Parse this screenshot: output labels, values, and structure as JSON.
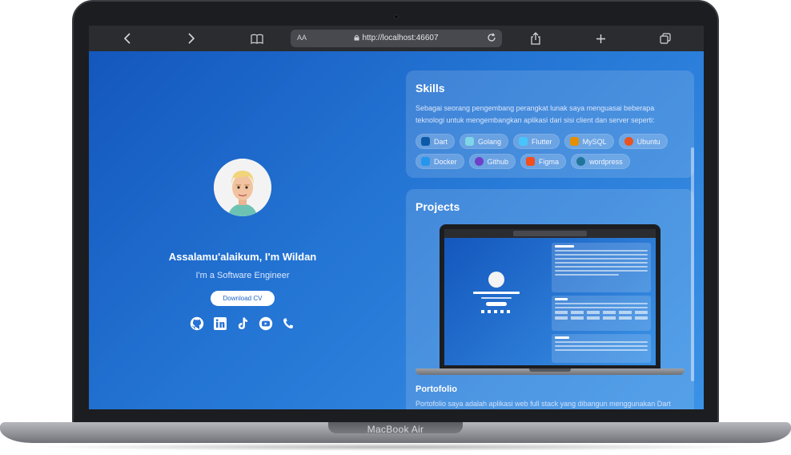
{
  "device": {
    "label": "MacBook Air"
  },
  "browser": {
    "back_icon": "chevron-left-icon",
    "forward_icon": "chevron-right-icon",
    "reader_icon": "book-icon",
    "text_size_label": "AA",
    "url": "http://localhost:46607",
    "reload_icon": "reload-icon",
    "share_icon": "share-icon",
    "new_tab_icon": "plus-icon",
    "tabs_icon": "tabs-icon"
  },
  "profile": {
    "greeting": "Assalamu'alaikum, I'm Wildan",
    "role": "I'm a Software Engineer",
    "cv_button": "Download CV",
    "socials": [
      "github-icon",
      "linkedin-icon",
      "tiktok-icon",
      "youtube-icon",
      "phone-icon"
    ]
  },
  "skills": {
    "title": "Skills",
    "description": "Sebagai seorang pengembang perangkat lunak saya menguasai beberapa teknologi untuk mengembangkan aplikasi dari sisi client dan server seperti:",
    "items": [
      {
        "label": "Dart",
        "color": "#0d5aa8"
      },
      {
        "label": "Golang",
        "color": "#7fd6e8"
      },
      {
        "label": "Flutter",
        "color": "#47c5fb"
      },
      {
        "label": "MySQL",
        "color": "#e48e00"
      },
      {
        "label": "Ubuntu",
        "color": "#e95420"
      },
      {
        "label": "Docker",
        "color": "#2496ed"
      },
      {
        "label": "Github",
        "color": "#6e40c9"
      },
      {
        "label": "Figma",
        "color": "#f24e1e"
      },
      {
        "label": "wordpress",
        "color": "#21759b"
      }
    ]
  },
  "projects": {
    "title": "Projects",
    "portfolio_title": "Portofolio",
    "portfolio_desc": "Portofolio saya adalah aplikasi web full stack yang dibangun menggunakan Dart"
  }
}
